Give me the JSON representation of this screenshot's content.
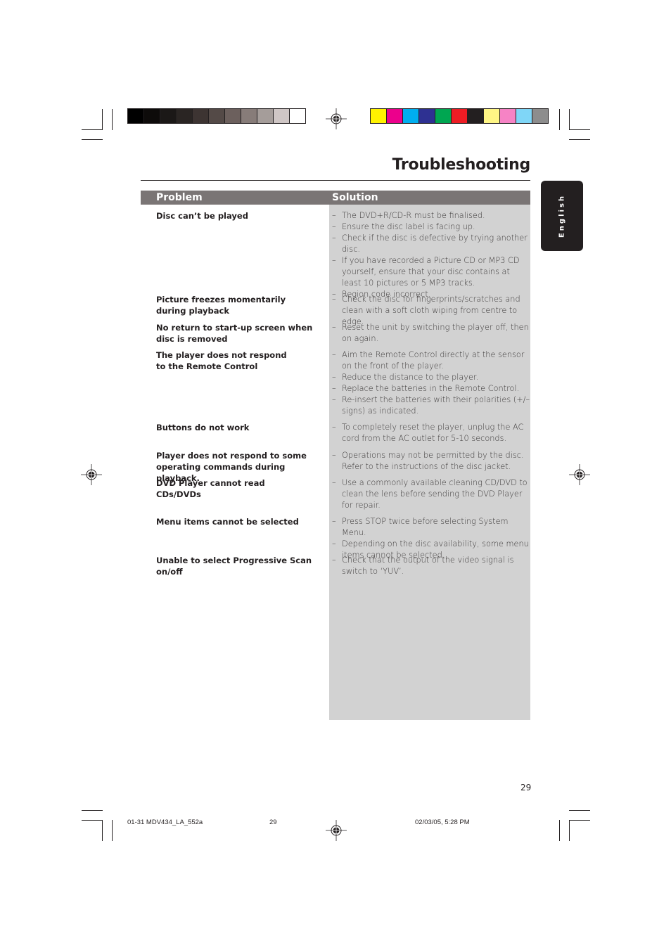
{
  "page": {
    "title": "Troubleshooting",
    "language_tab": "English",
    "page_number": "29"
  },
  "table": {
    "headers": {
      "problem": "Problem",
      "solution": "Solution"
    },
    "rows": [
      {
        "problem": "Disc can’t be played",
        "solutions": [
          "The DVD+R/CD-R must be finalised.",
          "Ensure the disc label is facing up.",
          "Check if the disc is defective by trying another disc.",
          "If you have recorded a Picture CD or MP3 CD yourself, ensure that your disc contains at least 10 pictures or 5 MP3 tracks.",
          "Region code incorrect."
        ]
      },
      {
        "problem": "Picture freezes momentarily during playback",
        "solutions": [
          "Check the disc for fingerprints/scratches and clean with a soft cloth wiping from centre to edge."
        ]
      },
      {
        "problem": "No return to start-up screen when disc is removed",
        "solutions": [
          "Reset the unit by switching the player off, then on again."
        ]
      },
      {
        "problem": "The player does not respond to the Remote Control",
        "solutions": [
          "Aim the Remote Control directly at the sensor on the front of the player.",
          "Reduce the distance to the player.",
          "Replace the batteries in the Remote Control.",
          "Re-insert the batteries with their polarities (+/– signs) as indicated."
        ]
      },
      {
        "problem": "Buttons do not work",
        "solutions": [
          "To completely reset the player, unplug the AC cord from the AC outlet for 5-10 seconds."
        ]
      },
      {
        "problem": "Player does not respond to some operating commands during playback.",
        "solutions": [
          "Operations may not be permitted by the disc. Refer to the instructions of  the disc jacket."
        ]
      },
      {
        "problem": "DVD Player cannot read CDs/DVDs",
        "solutions": [
          "Use a commonly available cleaning CD/DVD to clean the lens before sending the DVD Player for repair."
        ]
      },
      {
        "problem": "Menu items cannot be selected",
        "solutions": [
          "Press STOP twice before selecting System Menu.",
          "Depending on the disc availability, some menu items cannot be selected."
        ]
      },
      {
        "problem": "Unable to select Progressive Scan on/off",
        "solutions": [
          "Check that the output of the video signal is switch to ‘YUV’."
        ]
      }
    ]
  },
  "footer": {
    "file_name": "01-31 MDV434_LA_552a",
    "page": "29",
    "date_time": "02/03/05, 5:28 PM"
  },
  "print_marks": {
    "grayscale_swatches": [
      "#000000",
      "#0d0b0a",
      "#1b1817",
      "#2a2523",
      "#3d3432",
      "#544a47",
      "#6c605d",
      "#877c79",
      "#a59d9a",
      "#cfc6c5",
      "#ffffff"
    ],
    "color_swatches": [
      "#fff200",
      "#ec008c",
      "#00aeef",
      "#2e3192",
      "#00a651",
      "#ed1c24",
      "#231f20",
      "#fff685",
      "#f683c5",
      "#7fd6f7",
      "#8d8d8d"
    ]
  }
}
